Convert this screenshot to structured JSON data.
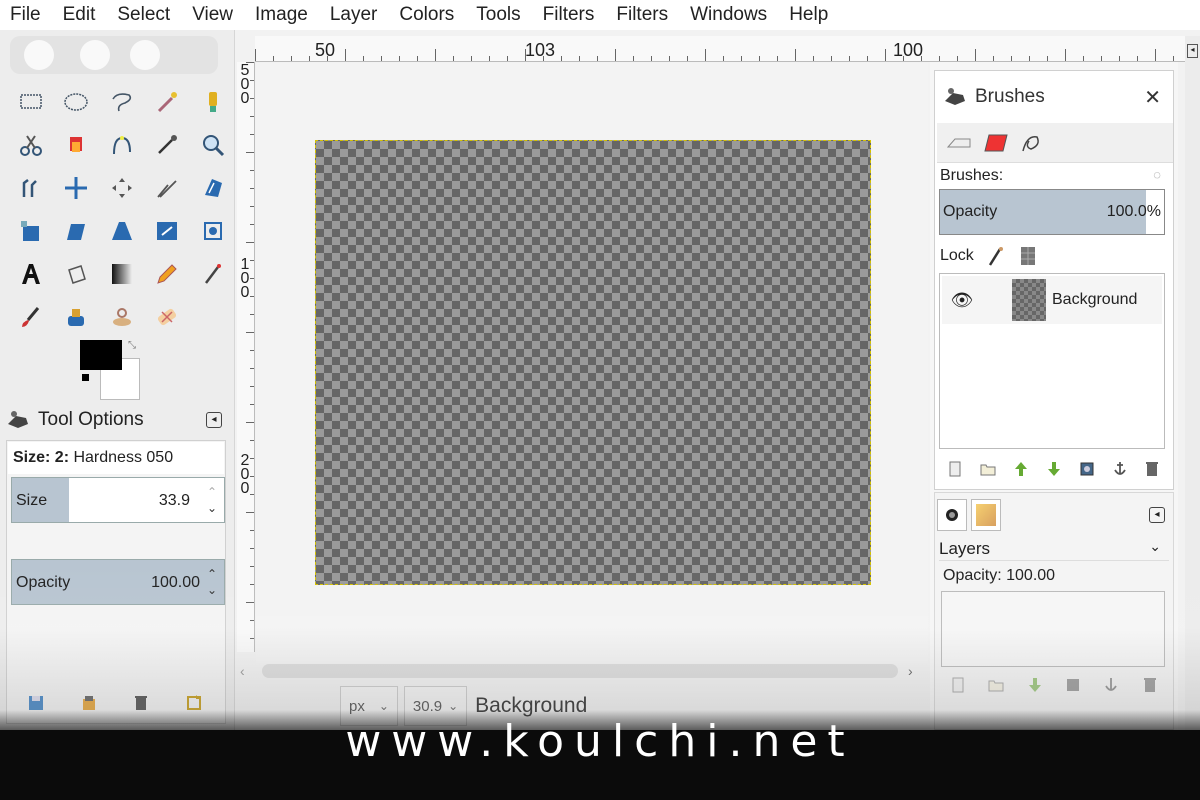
{
  "menu": [
    "File",
    "Edit",
    "Select",
    "View",
    "Image",
    "Layer",
    "Colors",
    "Tools",
    "Filters",
    "Filters",
    "Windows",
    "Help"
  ],
  "ruler": {
    "h_labels": [
      "50",
      "103",
      "100"
    ],
    "v_labels": [
      "500",
      "100",
      "200"
    ]
  },
  "tool_options": {
    "title": "Tool Options",
    "brush_prefix": "Size: 2:",
    "brush_name": "Hardness 050",
    "size_label": "Size",
    "size_value": "33.9",
    "size_fill": 0.27,
    "opacity_label": "Opacity",
    "opacity_value": "100.00",
    "opacity_fill": 1.0
  },
  "tools": [
    "rect-select-icon",
    "ellipse-select-icon",
    "lasso-icon",
    "fuzzy-select-icon",
    "paint-select-icon",
    "scissors-icon",
    "foreground-select-icon",
    "paths-icon",
    "color-picker-icon",
    "zoom-icon",
    "measure-icon",
    "move-icon",
    "align-icon",
    "crop-icon",
    "rotate-icon",
    "unified-transform-icon",
    "shear-icon",
    "perspective-icon",
    "flip-icon",
    "cage-icon",
    "text-icon",
    "bucket-fill-icon",
    "gradient-icon",
    "pencil-icon",
    "airbrush-icon",
    "paintbrush-icon",
    "ink-icon",
    "clone-icon",
    "heal-icon"
  ],
  "status": {
    "unit": "px",
    "zoom": "30.9",
    "layer_name": "Background"
  },
  "brushes_panel": {
    "title": "Brushes",
    "brushes_label": "Brushes:",
    "opacity_label": "Opacity",
    "opacity_value": "100.0%",
    "opacity_fill": 0.92,
    "lock_label": "Lock",
    "layer_name": "Background"
  },
  "layers_panel": {
    "title": "Layers",
    "opacity_text": "Opacity: 100.00"
  },
  "watermark": "www.koulchi.net",
  "colors": {
    "fill": "#b8c5d1",
    "selection": "#d4c200",
    "fg": "#000000",
    "bg": "#ffffff"
  }
}
